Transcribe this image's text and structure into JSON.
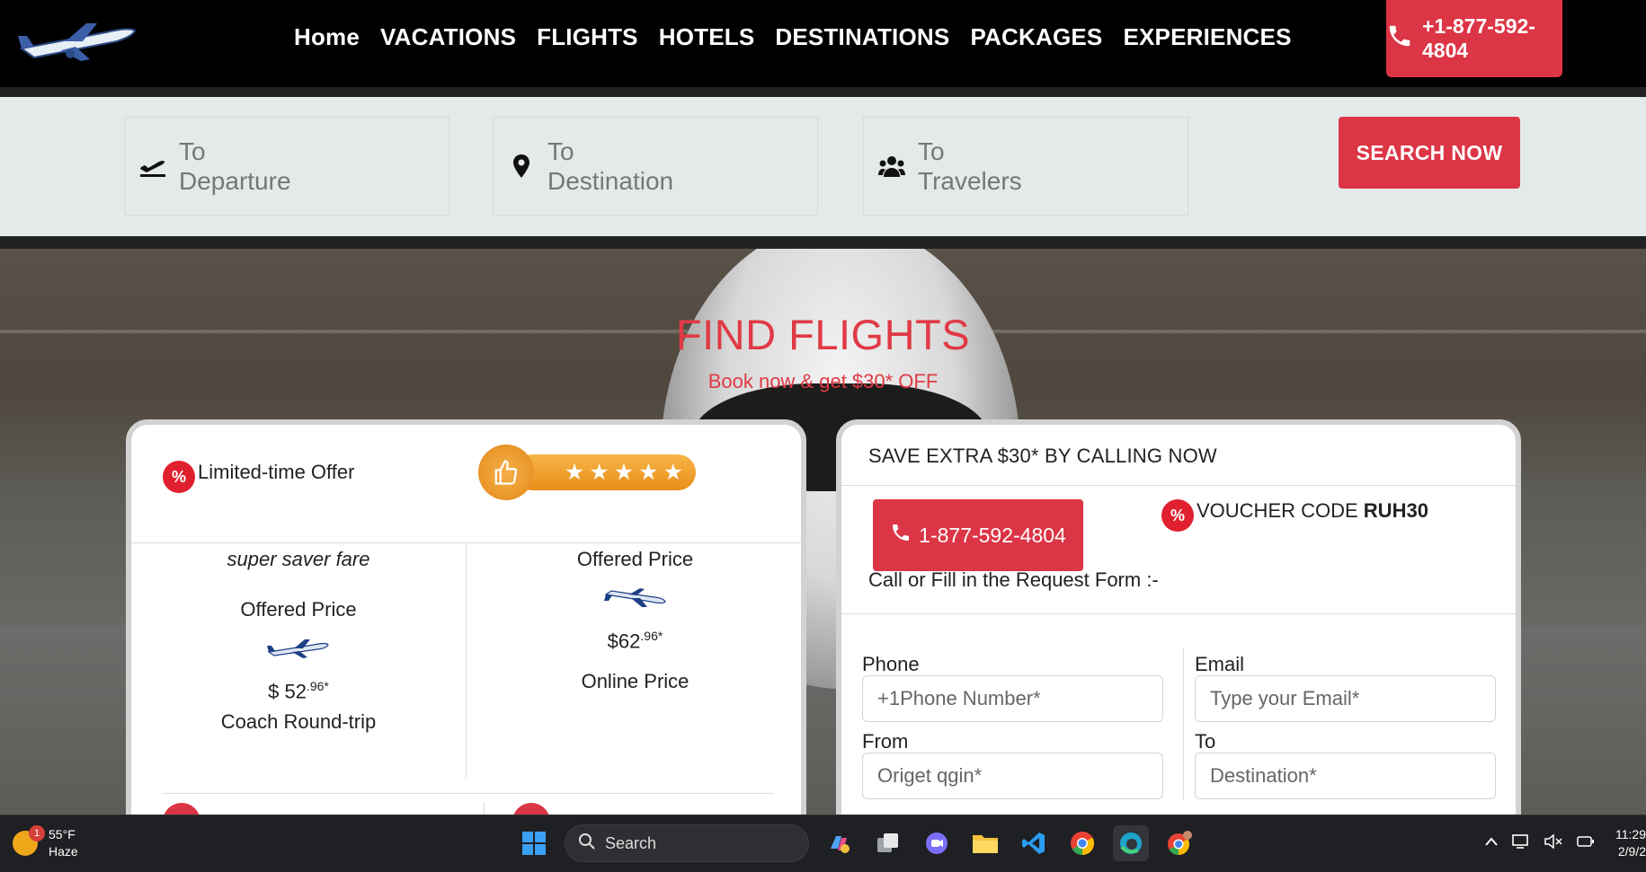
{
  "header": {
    "nav": [
      "Home",
      "VACATIONS",
      "FLIGHTS",
      "HOTELS",
      "DESTINATIONS",
      "PACKAGES",
      "EXPERIENCES"
    ],
    "phone": "+1-877-592-4804",
    "logo_icon": "airplane-logo"
  },
  "search": {
    "departure": {
      "line1": "To",
      "line2": "Departure",
      "icon": "plane-departure-icon"
    },
    "destination": {
      "line1": "To",
      "line2": "Destination",
      "icon": "map-pin-icon"
    },
    "travelers": {
      "line1": "To",
      "line2": "Travelers",
      "icon": "users-icon"
    },
    "button": "SEARCH NOW"
  },
  "hero": {
    "title": "FIND FLIGHTS",
    "subtitle": "Book now & get $30* OFF"
  },
  "offer": {
    "limited": "Limited-time Offer",
    "rating_stars": 5,
    "star_glyph": "★",
    "col1": {
      "fare": "super saver fare",
      "label": "Offered Price",
      "price_main": "$ 52",
      "price_sup": ".96*",
      "note": "Coach Round-trip"
    },
    "col2": {
      "label": "Offered Price",
      "price_main": "$62",
      "price_sup": ".96*",
      "note": "Online Price"
    }
  },
  "form": {
    "heading": "SAVE EXTRA $30* BY CALLING NOW",
    "call_phone": "1-877-592-4804",
    "voucher_label": "VOUCHER CODE ",
    "voucher_code": "RUH30",
    "call_fill": "Call or Fill in the Request Form :-",
    "phone_label": "Phone",
    "phone_placeholder": "+1Phone Number*",
    "email_label": "Email",
    "email_placeholder": "Type your Email*",
    "from_label": "From",
    "from_placeholder": "Origet qgin*",
    "to_label": "To",
    "to_placeholder": "Destination*"
  },
  "taskbar": {
    "temp": "55°F",
    "condition": "Haze",
    "weather_badge": "1",
    "search": "Search",
    "time": "11:29",
    "date": "2/9/2"
  },
  "colors": {
    "accent": "#dc3545",
    "hero_title": "#e03a45",
    "header_bg": "#000000",
    "searchbar_bg": "#e4e9ea"
  }
}
